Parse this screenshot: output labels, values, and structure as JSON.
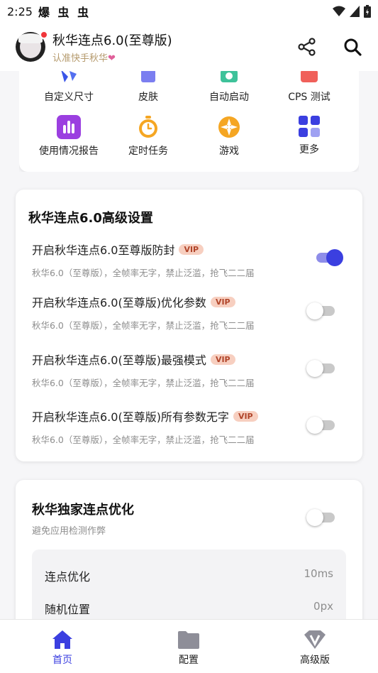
{
  "status_bar": {
    "time": "2:25",
    "notifications": "爆 虫 虫"
  },
  "header": {
    "title": "秋华连点6.0(至尊版)",
    "subtitle": "认准快手秋华",
    "subtitle_icon": "heart-icon",
    "actions": [
      "share-icon",
      "search-icon"
    ]
  },
  "grid": {
    "row1": [
      {
        "label": "自定义尺寸",
        "icon": "resize-icon"
      },
      {
        "label": "皮肤",
        "icon": "skin-icon"
      },
      {
        "label": "自动启动",
        "icon": "autostart-icon"
      },
      {
        "label": "CPS 测试",
        "icon": "cps-test-icon"
      }
    ],
    "row2": [
      {
        "label": "使用情况报告",
        "icon": "bar-chart-icon"
      },
      {
        "label": "定时任务",
        "icon": "timer-icon"
      },
      {
        "label": "游戏",
        "icon": "game-icon"
      },
      {
        "label": "更多",
        "icon": "more-grid-icon"
      }
    ]
  },
  "advanced": {
    "title": "秋华连点6.0高级设置",
    "vip_label": "VIP",
    "settings": [
      {
        "title": "开启秋华连点6.0至尊版防封",
        "desc": "秋华6.0（至尊版），全帧率无字，禁止泛滥，抢飞二二届",
        "enabled": true
      },
      {
        "title": "开启秋华连点6.0(至尊版)优化参数",
        "desc": "秋华6.0（至尊版），全帧率无字，禁止泛滥，抢飞二二届",
        "enabled": false
      },
      {
        "title": "开启秋华连点6.0(至尊版)最强模式",
        "desc": "秋华6.0（至尊版），全帧率无字，禁止泛滥，抢飞二二届",
        "enabled": false
      },
      {
        "title": "开启秋华连点6.0(至尊版)所有参数无字",
        "desc": "秋华6.0（至尊版），全帧率无字，禁止泛滥，抢飞二二届",
        "enabled": false
      }
    ]
  },
  "optimization": {
    "title": "秋华独家连点优化",
    "subtitle": "避免应用检测作弊",
    "enabled": false,
    "rows": [
      {
        "label": "连点优化",
        "value": "10ms"
      },
      {
        "label": "随机位置",
        "value": "0px"
      }
    ]
  },
  "bottom_nav": {
    "items": [
      {
        "label": "首页",
        "icon": "home-icon",
        "active": true
      },
      {
        "label": "配置",
        "icon": "folder-icon",
        "active": false
      },
      {
        "label": "高级版",
        "icon": "premium-v-icon",
        "active": false
      }
    ]
  },
  "colors": {
    "accent": "#3b3fe0",
    "vip_bg": "#f7cfc0",
    "vip_text": "#b1452a",
    "subtitle_gold": "#b59a6d"
  }
}
